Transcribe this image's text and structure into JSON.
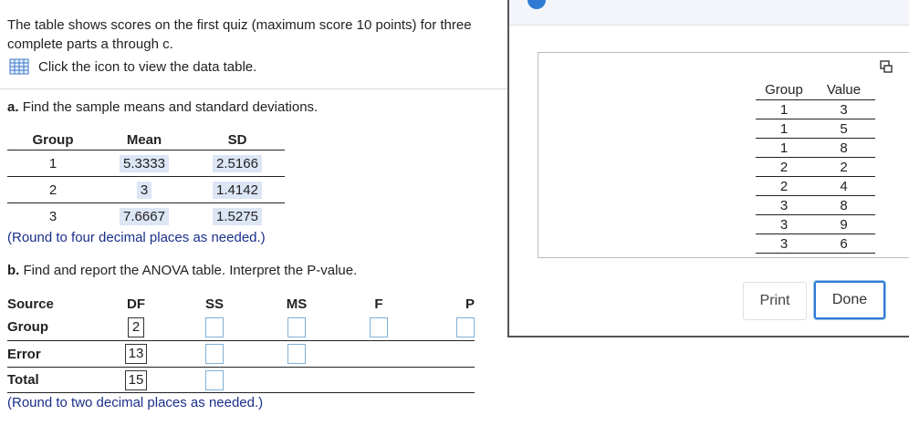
{
  "intro": {
    "line1": "The table shows scores on the first quiz (maximum score 10 points) for three",
    "line2": "complete parts a through c.",
    "link": "Click the icon to view the data table."
  },
  "part_a": {
    "prompt_label": "a.",
    "prompt_text": "Find the sample means and standard deviations.",
    "headers": [
      "Group",
      "Mean",
      "SD"
    ],
    "rows": [
      {
        "group": "1",
        "mean": "5.3333",
        "sd": "2.5166"
      },
      {
        "group": "2",
        "mean": "3",
        "sd": "1.4142"
      },
      {
        "group": "3",
        "mean": "7.6667",
        "sd": "1.5275"
      }
    ],
    "note": "(Round to four decimal places as needed.)"
  },
  "part_b": {
    "prompt_label": "b.",
    "prompt_text": "Find and report the ANOVA table. Interpret the P-value.",
    "headers": [
      "Source",
      "DF",
      "SS",
      "MS",
      "F",
      "P"
    ],
    "rows": [
      {
        "source": "Group",
        "df": "2"
      },
      {
        "source": "Error",
        "df": "13"
      },
      {
        "source": "Total",
        "df": "15"
      }
    ],
    "note": "(Round to two decimal places as needed.)"
  },
  "popup": {
    "headers": [
      "Group",
      "Value"
    ],
    "rows": [
      [
        "1",
        "3"
      ],
      [
        "1",
        "5"
      ],
      [
        "1",
        "8"
      ],
      [
        "2",
        "2"
      ],
      [
        "2",
        "4"
      ],
      [
        "3",
        "8"
      ],
      [
        "3",
        "9"
      ],
      [
        "3",
        "6"
      ]
    ],
    "print_label": "Print",
    "done_label": "Done"
  },
  "colors": {
    "accent": "#2f7bd4",
    "highlight": "#dde6f5",
    "note_text": "#1a2f8a"
  }
}
